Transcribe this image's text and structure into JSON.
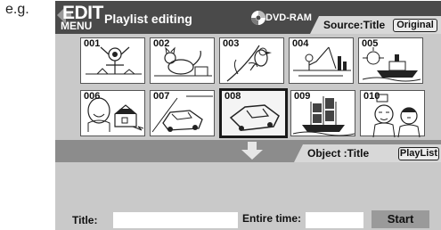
{
  "prefix": "e.g.",
  "header": {
    "edit_label": "EDIT",
    "menu_label": "MENU",
    "title": "Playlist editing",
    "disc_label": "DVD-RAM"
  },
  "source": {
    "label": "Source:Title",
    "button": "Original"
  },
  "thumbnails": [
    {
      "number": "001",
      "icon": "scarecrow-icon"
    },
    {
      "number": "002",
      "icon": "cat-icon"
    },
    {
      "number": "003",
      "icon": "bird-icon"
    },
    {
      "number": "004",
      "icon": "fishing-icon"
    },
    {
      "number": "005",
      "icon": "ship-icon"
    },
    {
      "number": "006",
      "icon": "house-icon"
    },
    {
      "number": "007",
      "icon": "car-icon"
    },
    {
      "number": "008",
      "icon": "car-icon"
    },
    {
      "number": "009",
      "icon": "sailing-ship-icon"
    },
    {
      "number": "010",
      "icon": "people-icon"
    }
  ],
  "selected_thumbnail": "008",
  "object": {
    "label": "Object :Title",
    "button": "PlayList"
  },
  "fields": {
    "title_label": "Title:",
    "title_value": "",
    "time_label": "Entire time:",
    "time_value": "",
    "start_label": "Start"
  },
  "colors": {
    "background": "#4a4a4a",
    "panel": "#c9c9c9",
    "band": "#8c8c8c",
    "tab": "#d8d8d8"
  }
}
